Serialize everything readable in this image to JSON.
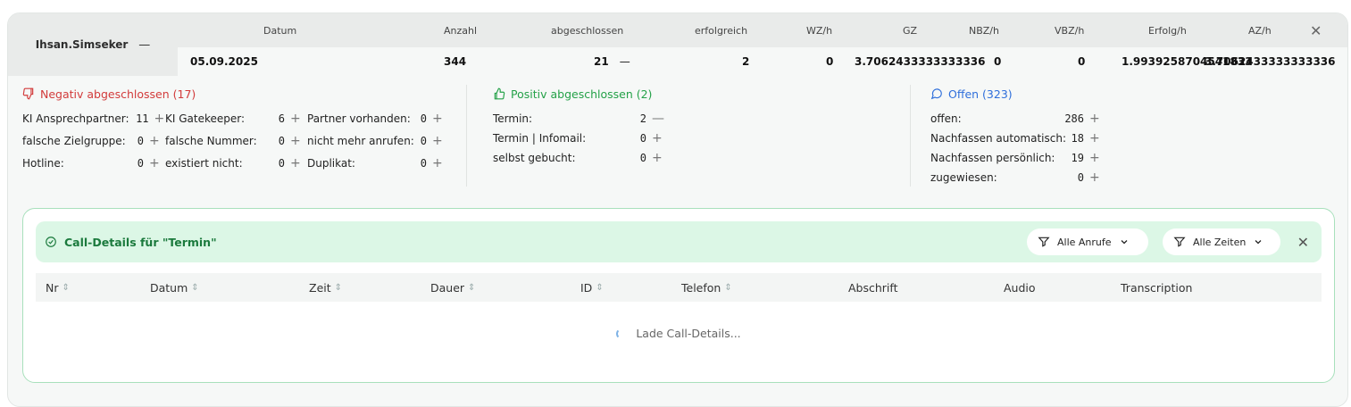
{
  "user": {
    "name": "Ihsan.Simseker",
    "collapse": "—"
  },
  "summary": {
    "headers": [
      "Datum",
      "Anzahl",
      "abgeschlossen",
      "erfolgreich",
      "WZ/h",
      "GZ",
      "NBZ/h",
      "VBZ/h",
      "Erfolg/h",
      "AZ/h"
    ],
    "close": "✕",
    "row": {
      "datum": "05.09.2025",
      "anzahl": "344",
      "abgeschlossen": "21",
      "abgeschlossen_toggle": "—",
      "erfolgreich": "2",
      "wz": "0",
      "gz": "3.7062433333333336",
      "nbz": "0",
      "vbz": "0",
      "erfolg": "1.9939258704541833",
      "az": "3.7062433333333336"
    }
  },
  "negative": {
    "title": "Negativ abgeschlossen (17)",
    "items": [
      {
        "label": "KI Ansprechpartner:",
        "value": "11",
        "action": "+"
      },
      {
        "label": "KI Gatekeeper:",
        "value": "6",
        "action": "+"
      },
      {
        "label": "Partner vorhanden:",
        "value": "0",
        "action": "+"
      },
      {
        "label": "falsche Zielgruppe:",
        "value": "0",
        "action": "+"
      },
      {
        "label": "falsche Nummer:",
        "value": "0",
        "action": "+"
      },
      {
        "label": "nicht mehr anrufen:",
        "value": "0",
        "action": "+"
      },
      {
        "label": "Hotline:",
        "value": "0",
        "action": "+"
      },
      {
        "label": "existiert nicht:",
        "value": "0",
        "action": "+"
      },
      {
        "label": "Duplikat:",
        "value": "0",
        "action": "+"
      }
    ]
  },
  "positive": {
    "title": "Positiv abgeschlossen (2)",
    "items": [
      {
        "label": "Termin:",
        "value": "2",
        "action": "—"
      },
      {
        "label": "Termin | Infomail:",
        "value": "0",
        "action": "+"
      },
      {
        "label": "selbst gebucht:",
        "value": "0",
        "action": "+"
      }
    ]
  },
  "open": {
    "title": "Offen (323)",
    "items": [
      {
        "label": "offen:",
        "value": "286",
        "action": "+"
      },
      {
        "label": "Nachfassen automatisch:",
        "value": "18",
        "action": "+"
      },
      {
        "label": "Nachfassen persönlich:",
        "value": "19",
        "action": "+"
      },
      {
        "label": "zugewiesen:",
        "value": "0",
        "action": "+"
      }
    ]
  },
  "details": {
    "title": "Call-Details für \"Termin\"",
    "filter_calls": "Alle Anrufe",
    "filter_times": "Alle Zeiten",
    "close": "✕",
    "columns": [
      "Nr",
      "Datum",
      "Zeit",
      "Dauer",
      "ID",
      "Telefon",
      "Abschrift",
      "Audio",
      "Transcription"
    ],
    "loading": "Lade Call-Details..."
  },
  "colors": {
    "negative": "#d23b3b",
    "positive": "#24a148",
    "open": "#2f6fdb",
    "accent_bg": "#dcf7e6"
  },
  "icons": {
    "negative": "thumbs-down-icon",
    "positive": "thumbs-up-icon",
    "open": "chat-bubble-icon",
    "check": "check-circle-icon",
    "filter": "filter-icon",
    "chevron": "chevron-down-icon",
    "sort": "sort-icon",
    "spinner": "spinner-icon"
  }
}
